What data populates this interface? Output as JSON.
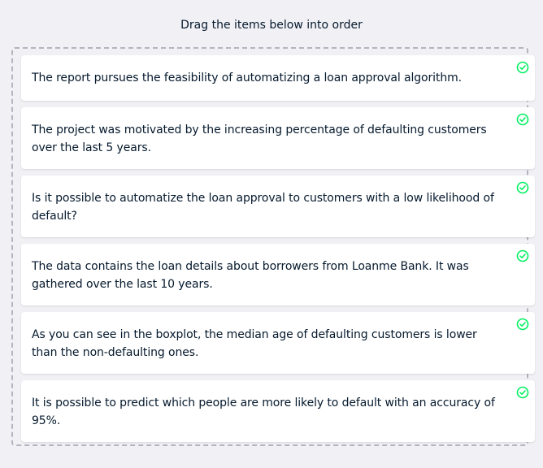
{
  "instruction": "Drag the items below into order",
  "accent_color": "#03ef62",
  "items": [
    {
      "text": "The report pursues the feasibility of automatizing a loan approval algorithm.",
      "status": "check-circle-icon"
    },
    {
      "text": "The project was motivated by the increasing percentage of defaulting customers over the last 5 years.",
      "status": "check-circle-icon"
    },
    {
      "text": "Is it possible to automatize the loan approval to customers with a low likelihood of default?",
      "status": "check-circle-icon"
    },
    {
      "text": "The data contains the loan details about borrowers from Loanme Bank. It was gathered over the last 10 years.",
      "status": "check-circle-icon"
    },
    {
      "text": "As you can see in the boxplot, the median age of defaulting customers is lower than the non-defaulting ones.",
      "status": "check-circle-icon"
    },
    {
      "text": "It is possible to predict which people are more likely to default with an accuracy of 95%.",
      "status": "check-circle-icon"
    }
  ]
}
